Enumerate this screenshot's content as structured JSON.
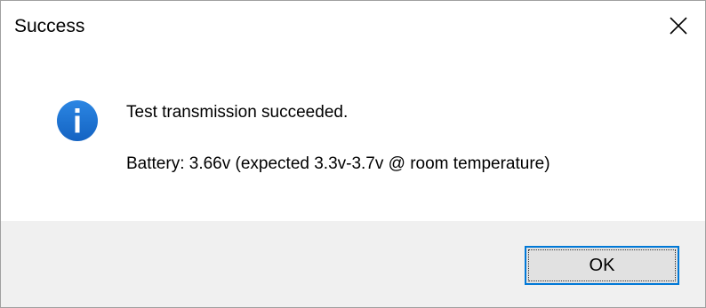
{
  "window": {
    "title": "Success",
    "close_icon": "close-icon"
  },
  "message": {
    "icon": "info-icon",
    "icon_color": "#1a6fd0",
    "line1": "Test transmission succeeded.",
    "line2": "Battery: 3.66v (expected 3.3v-3.7v @ room temperature)"
  },
  "buttons": {
    "ok_label": "OK",
    "ok_border_color": "#0078d7"
  }
}
